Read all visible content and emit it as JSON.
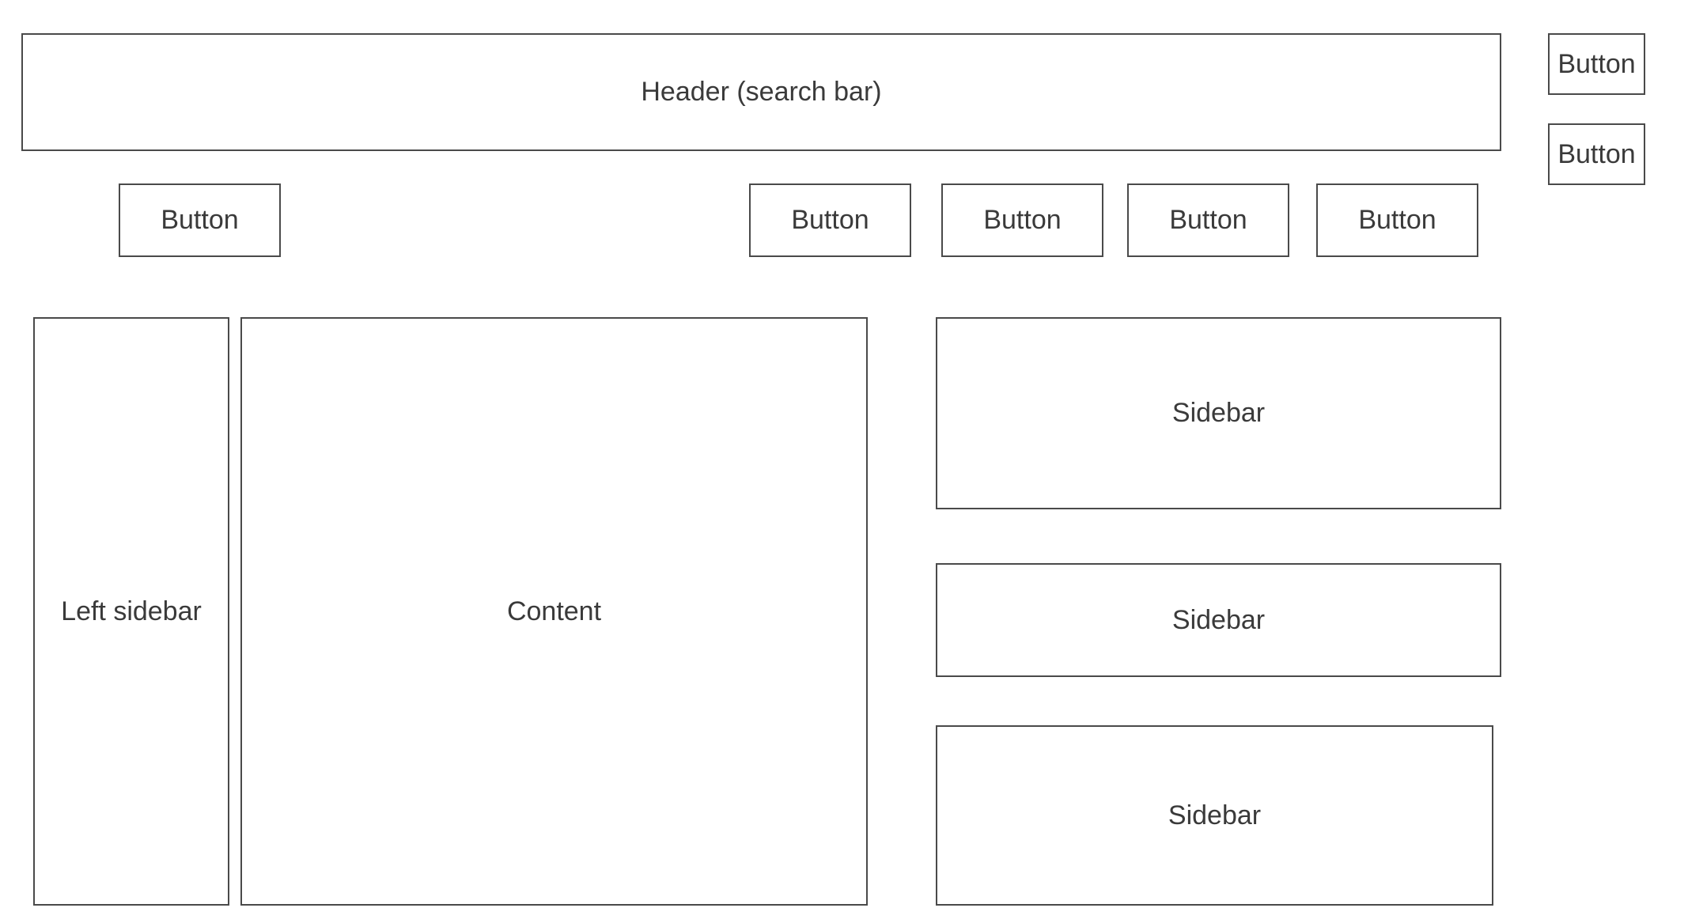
{
  "header": {
    "label": "Header (search bar)"
  },
  "top_right_buttons": [
    {
      "label": "Button"
    },
    {
      "label": "Button"
    }
  ],
  "toolbar": {
    "buttons": [
      {
        "label": "Button"
      },
      {
        "label": "Button"
      },
      {
        "label": "Button"
      },
      {
        "label": "Button"
      },
      {
        "label": "Button"
      }
    ]
  },
  "main": {
    "left_sidebar": {
      "label": "Left sidebar"
    },
    "content": {
      "label": "Content"
    },
    "sidebars": [
      {
        "label": "Sidebar"
      },
      {
        "label": "Sidebar"
      },
      {
        "label": "Sidebar"
      }
    ]
  },
  "colors": {
    "border": "#4a4a4a",
    "text": "#3a3a3a",
    "background": "#ffffff"
  }
}
